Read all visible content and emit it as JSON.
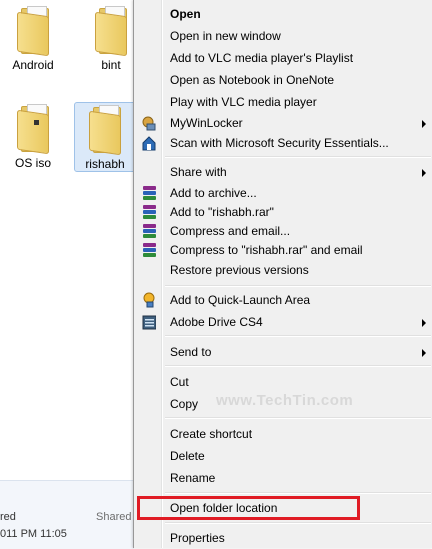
{
  "desktop": {
    "items": [
      {
        "label": "Android"
      },
      {
        "label": "bint"
      },
      {
        "label": "OS iso"
      },
      {
        "label": "rishabh"
      }
    ]
  },
  "status": {
    "left_top": "red",
    "shared": "Shared",
    "date": "011 PM 11:05"
  },
  "menu": {
    "open": "Open",
    "open_new_window": "Open in new window",
    "vlc_playlist": "Add to VLC media player's Playlist",
    "onenote": "Open as Notebook in OneNote",
    "vlc_play": "Play with VLC media player",
    "mywinlocker": "MyWinLocker",
    "scan": "Scan with Microsoft Security Essentials...",
    "share_with": "Share with",
    "add_archive": "Add to archive...",
    "add_rar": "Add to \"rishabh.rar\"",
    "compress_email": "Compress and email...",
    "compress_rar_email": "Compress to \"rishabh.rar\" and email",
    "restore": "Restore previous versions",
    "quicklaunch": "Add to Quick-Launch Area",
    "adobe_drive": "Adobe Drive CS4",
    "send_to": "Send to",
    "cut": "Cut",
    "copy": "Copy",
    "create_shortcut": "Create shortcut",
    "delete": "Delete",
    "rename": "Rename",
    "open_folder_location": "Open folder location",
    "properties": "Properties"
  },
  "watermark": "www.TechTin.com",
  "colors": {
    "highlight": "#e01b24",
    "selection": "#dbe9f9",
    "menu_bg": "#f0f0f0"
  }
}
